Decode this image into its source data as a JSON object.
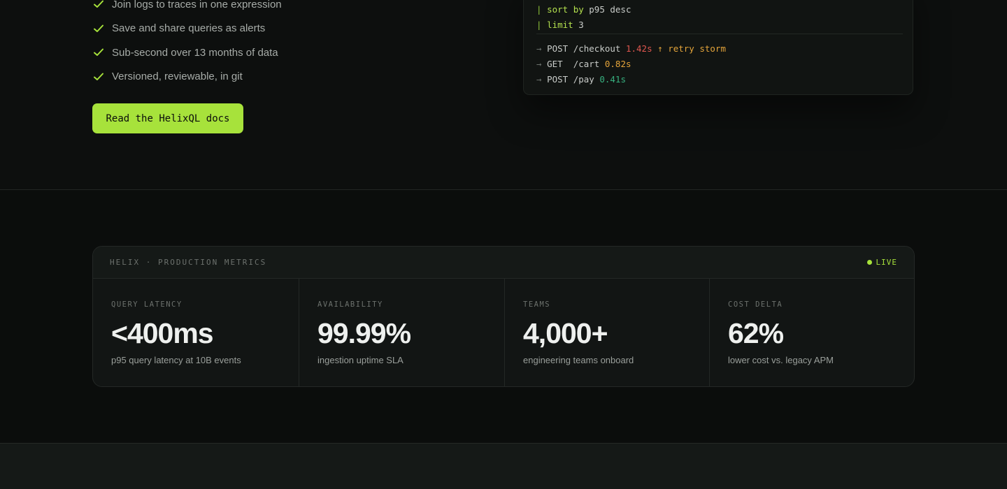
{
  "features": {
    "items": [
      "Join logs to traces in one expression",
      "Save and share queries as alerts",
      "Sub-second over 13 months of data",
      "Versioned, reviewable, in git"
    ],
    "check_icon": "check-icon",
    "accent_color": "#a7e23b"
  },
  "docs_button": {
    "label": "Read the HelixQL docs"
  },
  "code": {
    "lines": [
      {
        "pipe": "|",
        "keyword": "sort by",
        "rest": "p95 desc"
      },
      {
        "pipe": "|",
        "keyword": "limit",
        "rest": "3"
      }
    ],
    "results": [
      {
        "arrow": "→",
        "method": "POST",
        "path": "/checkout",
        "latency": "1.42s",
        "note": "↑ retry storm"
      },
      {
        "arrow": "→",
        "method": "GET ",
        "path": "/cart",
        "latency": "0.82s",
        "note": ""
      },
      {
        "arrow": "→",
        "method": "POST",
        "path": "/pay",
        "latency": "0.41s",
        "note": ""
      }
    ]
  },
  "metrics": {
    "title": "HELIX · PRODUCTION METRICS",
    "live_label": "LIVE",
    "cells": [
      {
        "label": "QUERY LATENCY",
        "value": "<400ms",
        "caption": "p95 query latency at 10B events"
      },
      {
        "label": "AVAILABILITY",
        "value": "99.99%",
        "caption": "ingestion uptime SLA"
      },
      {
        "label": "TEAMS",
        "value": "4,000+",
        "caption": "engineering teams onboard"
      },
      {
        "label": "COST DELTA",
        "value": "62%",
        "caption": "lower cost vs. legacy APM"
      }
    ]
  }
}
